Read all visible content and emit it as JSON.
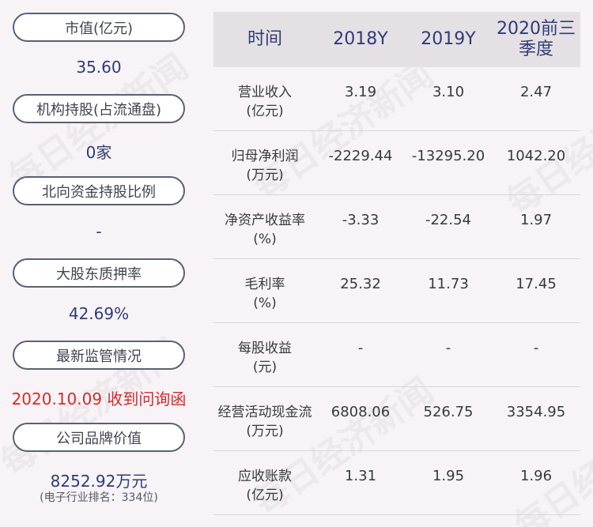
{
  "watermark_text": "每日经济新闻",
  "left_panel": {
    "items": [
      {
        "label": "市值(亿元)",
        "value": "35.60"
      },
      {
        "label": "机构持股(占流通盘)",
        "value": "0家"
      },
      {
        "label": "北向资金持股比例",
        "value": "-"
      },
      {
        "label": "大股东质押率",
        "value": "42.69%"
      },
      {
        "label": "最新监管情况",
        "value": "2020.10.09 收到问询函"
      },
      {
        "label": "公司品牌价值",
        "value": "8252.92万元",
        "note": "(电子行业排名：334位)"
      }
    ]
  },
  "table": {
    "headers": [
      "时间",
      "2018Y",
      "2019Y",
      "2020前三季度"
    ],
    "rows": [
      {
        "name": "营业收入",
        "unit": "(亿元)",
        "values": [
          "3.19",
          "3.10",
          "2.47"
        ]
      },
      {
        "name": "归母净利润",
        "unit": "(万元)",
        "values": [
          "-2229.44",
          "-13295.20",
          "1042.20"
        ]
      },
      {
        "name": "净资产收益率",
        "unit": "(%)",
        "values": [
          "-3.33",
          "-22.54",
          "1.97"
        ]
      },
      {
        "name": "毛利率",
        "unit": "(%)",
        "values": [
          "25.32",
          "11.73",
          "17.45"
        ]
      },
      {
        "name": "每股收益",
        "unit": "(元)",
        "values": [
          "-",
          "-",
          "-"
        ]
      },
      {
        "name": "经营活动现金流",
        "unit": "(万元)",
        "values": [
          "6808.06",
          "526.75",
          "3354.95"
        ]
      },
      {
        "name": "应收账款",
        "unit": "(亿元)",
        "values": [
          "1.31",
          "1.95",
          "1.96"
        ]
      }
    ]
  },
  "colors": {
    "accent": "#2e3c78",
    "alert": "#d62b2b",
    "header_bg": "#e4e0e3",
    "page_bg": "#f7f3f6"
  }
}
